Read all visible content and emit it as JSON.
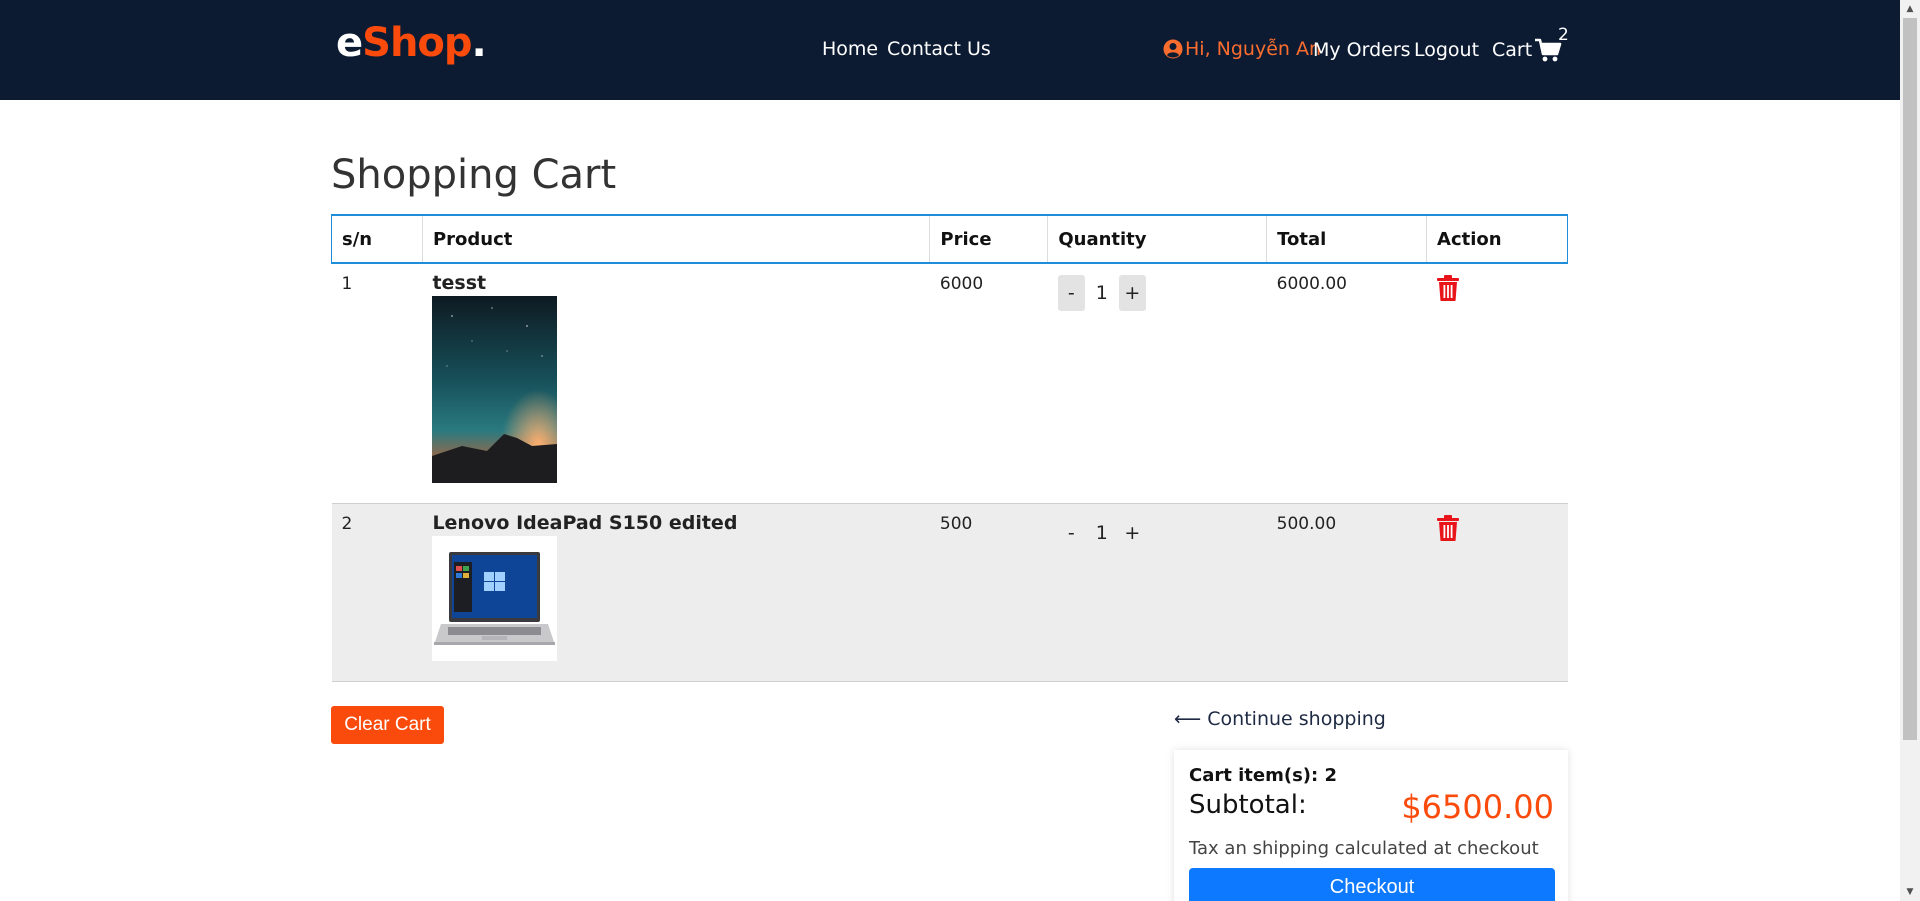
{
  "header": {
    "logo": {
      "part1": "e",
      "part2": "Shop",
      "part3": "."
    },
    "nav": {
      "home": "Home",
      "contact": "Contact Us"
    },
    "greeting": "Hi, Nguyễn An",
    "my_orders": "My Orders",
    "logout": "Logout",
    "cart_label": "Cart",
    "cart_count": "2"
  },
  "page_title": "Shopping Cart",
  "table": {
    "headers": [
      "s/n",
      "Product",
      "Price",
      "Quantity",
      "Total",
      "Action"
    ],
    "rows": [
      {
        "sn": "1",
        "name": "tesst",
        "price": "6000",
        "qty": "1",
        "total": "6000.00",
        "image": "night-sky-landscape"
      },
      {
        "sn": "2",
        "name": "Lenovo IdeaPad S150 edited",
        "price": "500",
        "qty": "1",
        "total": "500.00",
        "image": "laptop"
      }
    ],
    "qty_minus": "-",
    "qty_plus": "+"
  },
  "clear_cart": "Clear Cart",
  "continue_shopping": "⟵ Continue shopping",
  "summary": {
    "items_label": "Cart item(s): 2",
    "subtotal_label": "Subtotal:",
    "subtotal_value": "$6500.00",
    "note": "Tax an shipping calculated at checkout",
    "checkout": "Checkout"
  },
  "colors": {
    "header_bg": "#0c1b32",
    "accent": "#fb4b0c",
    "checkout": "#0d79ff",
    "table_border": "#1f8ed8",
    "trash": "#e8141a"
  }
}
